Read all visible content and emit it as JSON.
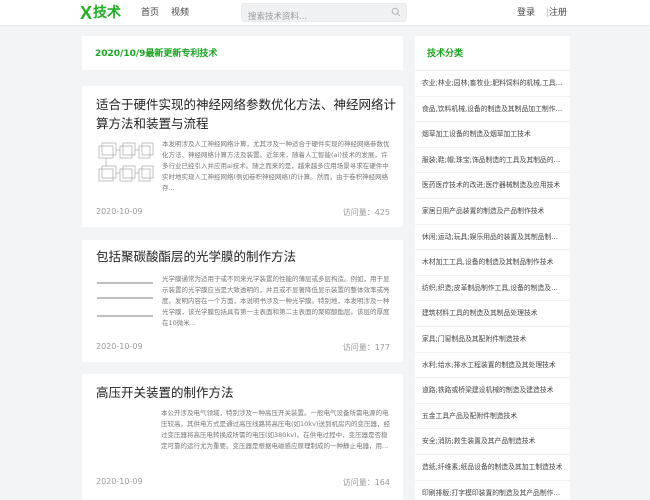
{
  "header": {
    "logo_mark": "X",
    "logo_text": "技术",
    "nav": [
      "首页",
      "视频"
    ],
    "search_placeholder": "搜索技术资料...",
    "login": "登录",
    "register": "注册"
  },
  "banner": {
    "title": "2020/10/9最新更新专利技术"
  },
  "articles": [
    {
      "title": "适合于硬件实现的神经网络参数优化方法、神经网络计算方法和装置与流程",
      "summary": "本发明涉及人工神经网络计算，尤其涉及一种适合于硬件实现的神经网络参数优化方法、神经网络计算方法及装置。近年来，随着人工智能(ai)技术的发展，许多行业已经引入并应用ai技术。随之而来的是，越来越多应用场景寻求在硬件中实时地实现人工神经网络(例如卷积神经网络)的计算。然而，由于卷积神经网络存...",
      "date": "2020-10-09",
      "views": "访问量：425"
    },
    {
      "title": "包括聚碳酸酯层的光学膜的制作方法",
      "summary": "光学膜通常为适用于或不同来光学装置的性能的薄层或多层构造。例如，用于显示装置的光学膜应当是大致透明的，并且或不显著降低显示装置的整体效率或亮度。发明内容在一个方面，本说明书涉及一种光学膜。特别地，本发明涉及一种光学膜，该光学膜包括具有第一主表面和第二主表面的聚碳酸酯层。该层的厚度在10微米...",
      "date": "2020-10-09",
      "views": "访问量：177"
    },
    {
      "title": "高压开关装置的制作方法",
      "summary": "本公开涉及电气领域，特别涉及一种高压开关装置。一般电气设备所需电源的电压较高，其供电方式是通过高压线路将高压电(如10kv)送到机房内的变压器，经过变压器将高压电转换成所需的电压(如380kv)。在供电过程中，变压器是否稳定可靠的运行尤为重要。变压器是根据电磁感应原理制成的一种静止电器，用...",
      "date": "2020-10-09",
      "views": "访问量：164"
    }
  ],
  "sidebar": {
    "title": "技术分类",
    "items": [
      "农业;林业;园林;畜牧业;肥料饲料的机械,工具的制造及其加工制品的制作,应用技术",
      "食品,饮料机械,设备的制造及其制品加工制作,储藏技术",
      "烟草加工设备的制造及烟草加工技术",
      "服装;鞋;帽;珠宝;饰品制造的工具及其制品的制作,应用技术",
      "医药医疗技术的改进;医疗器械制造及应用技术",
      "家居日用产品装置的制造及产品制作技术",
      "休闲;运动;玩具;娱乐用品的装置及其制品制作技术",
      "木材加工工具,设备的制造及其制品制作技术",
      "纺织;织造;皮革制品制作工具,设备的制造及其制品的制作技术",
      "建筑材料工具的制造及其制品处理技术",
      "家具;门窗制品及其配附件制造技术",
      "水利;给水;排水工程装置的制造及其处理技术",
      "道路;铁路或桥梁建设机械的制造及建造技术",
      "五金工具产品及配附件制造技术",
      "安全;消防;救生装置及其产品制造技术",
      "造纸;纤维素;纸品设备的制造及其加工制造技术",
      "印刷排版;打字模印装置的制造及其产品制作技术"
    ]
  },
  "colors": {
    "accent": "#1eb01e",
    "heading_green": "#19a51f"
  },
  "icons": {
    "search": "search-icon"
  }
}
